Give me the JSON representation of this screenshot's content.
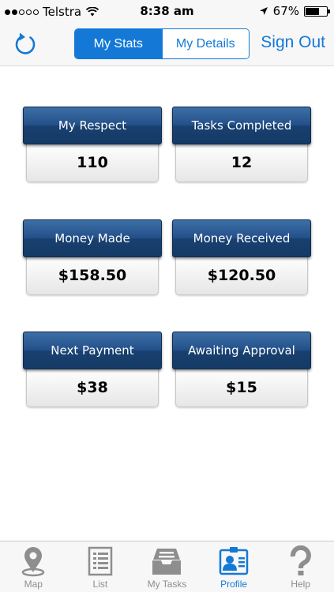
{
  "status_bar": {
    "carrier": "Telstra",
    "time": "8:38 am",
    "battery": "67%",
    "battery_level": 0.67,
    "signal_strength": 2,
    "signal_max": 5
  },
  "nav": {
    "segments": [
      "My Stats",
      "My Details"
    ],
    "selected_segment": "My Stats",
    "sign_out_label": "Sign Out",
    "accent_color": "#1479d6",
    "refresh_icon": "refresh-icon"
  },
  "stats": [
    {
      "label": "My Respect",
      "value": "110"
    },
    {
      "label": "Tasks Completed",
      "value": "12"
    },
    {
      "label": "Money Made",
      "value": "$158.50"
    },
    {
      "label": "Money Received",
      "value": "$120.50"
    },
    {
      "label": "Next Payment",
      "value": "$38"
    },
    {
      "label": "Awaiting Approval",
      "value": "$15"
    }
  ],
  "tab_bar": {
    "tabs": [
      {
        "label": "Map",
        "icon": "map-pin-icon"
      },
      {
        "label": "List",
        "icon": "list-icon"
      },
      {
        "label": "My Tasks",
        "icon": "tray-icon"
      },
      {
        "label": "Profile",
        "icon": "id-badge-icon"
      },
      {
        "label": "Help",
        "icon": "question-icon"
      }
    ],
    "selected_tab": "Profile"
  }
}
